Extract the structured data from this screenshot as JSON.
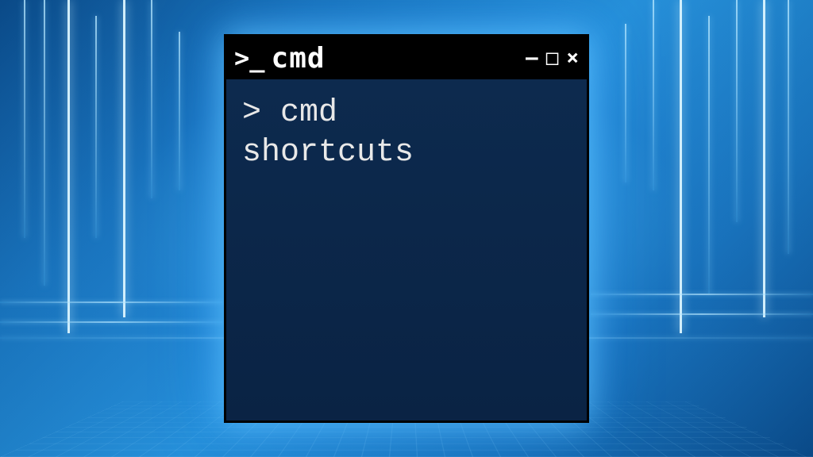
{
  "titlebar": {
    "icon_prompt": ">_",
    "title": "cmd",
    "controls": {
      "minimize": "—",
      "maximize": "□",
      "close": "×"
    }
  },
  "terminal": {
    "prompt": "> ",
    "line1": "cmd",
    "line2": "shortcuts"
  },
  "colors": {
    "terminal_bg": "#0b2545",
    "titlebar_bg": "#000000",
    "text": "#e8e8e8"
  }
}
